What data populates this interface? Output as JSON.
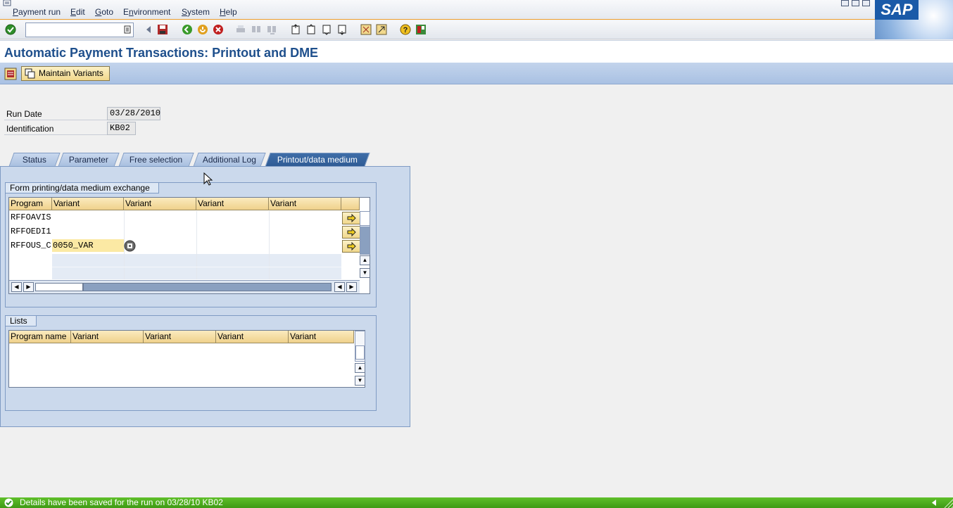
{
  "menu": [
    "Payment run",
    "Edit",
    "Goto",
    "Environment",
    "System",
    "Help"
  ],
  "menu_underline": [
    "P",
    "E",
    "G",
    "n",
    "S",
    "H"
  ],
  "logo_text": "SAP",
  "command_field": {
    "value": ""
  },
  "toolbar_icons": [
    "enter-icon",
    "command-dropdown-icon",
    "back-nav-icon",
    "save-icon",
    "back-icon",
    "exit-icon",
    "cancel-icon",
    "print-icon",
    "find-icon",
    "find-next-icon",
    "first-page-icon",
    "previous-page-icon",
    "next-page-icon",
    "last-page-icon",
    "create-session-icon",
    "shortcut-icon",
    "help-icon",
    "layout-menu-icon"
  ],
  "title": "Automatic Payment Transactions: Printout and DME",
  "app_toolbar": {
    "maintain_variants": "Maintain Variants"
  },
  "header_fields": [
    {
      "label": "Run Date",
      "value": "03/28/2010"
    },
    {
      "label": "Identification",
      "value": "KB02"
    }
  ],
  "tabs": [
    {
      "label": "Status",
      "active": false
    },
    {
      "label": "Parameter",
      "active": false
    },
    {
      "label": "Free selection",
      "active": false
    },
    {
      "label": "Additional Log",
      "active": false
    },
    {
      "label": "Printout/data medium",
      "active": true
    }
  ],
  "form_group": {
    "title": "Form printing/data medium exchange",
    "columns": [
      "Program",
      "Variant",
      "Variant",
      "Variant",
      "Variant"
    ],
    "rows": [
      {
        "program": "RFFOAVIS",
        "variant": ""
      },
      {
        "program": "RFFOEDI1",
        "variant": ""
      },
      {
        "program": "RFFOUS_C",
        "variant": "0050_VAR"
      }
    ]
  },
  "lists_group": {
    "title": "Lists",
    "columns": [
      "Program name",
      "Variant",
      "Variant",
      "Variant",
      "Variant"
    ]
  },
  "status_bar": {
    "message": "Details have been saved for the run on 03/28/10 KB02"
  },
  "colors": {
    "accent": "#1e4f8c",
    "status_ok": "#4aa81c",
    "header_cell": "#f3dc9c",
    "panel": "#cbd9ec"
  }
}
